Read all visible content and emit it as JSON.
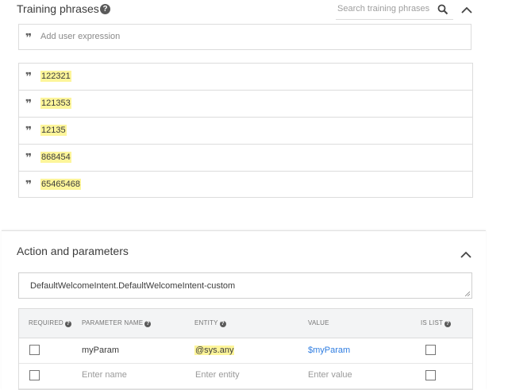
{
  "training_phrases": {
    "title": "Training phrases",
    "search_placeholder": "Search training phrases",
    "add_placeholder": "Add user expression",
    "phrases": [
      "122321",
      "121353",
      "12135",
      "868454",
      "65465468"
    ]
  },
  "action_parameters": {
    "title": "Action and parameters",
    "action_value": "DefaultWelcomeIntent.DefaultWelcomeIntent-custom",
    "columns": {
      "required": "REQUIRED",
      "parameter_name": "PARAMETER NAME",
      "entity": "ENTITY",
      "value": "VALUE",
      "is_list": "IS LIST"
    },
    "rows": [
      {
        "name": "myParam",
        "entity": "@sys.any",
        "value": "$myParam"
      }
    ],
    "new_row": {
      "name_placeholder": "Enter name",
      "entity_placeholder": "Enter entity",
      "value_placeholder": "Enter value"
    }
  },
  "icons": {
    "help": "help-icon",
    "search": "search-icon",
    "collapse": "chevron-up-icon",
    "quote": "quote-icon"
  },
  "colors": {
    "highlight": "#fdf59a",
    "link": "#2f7de1",
    "border": "#dcdcdc"
  }
}
